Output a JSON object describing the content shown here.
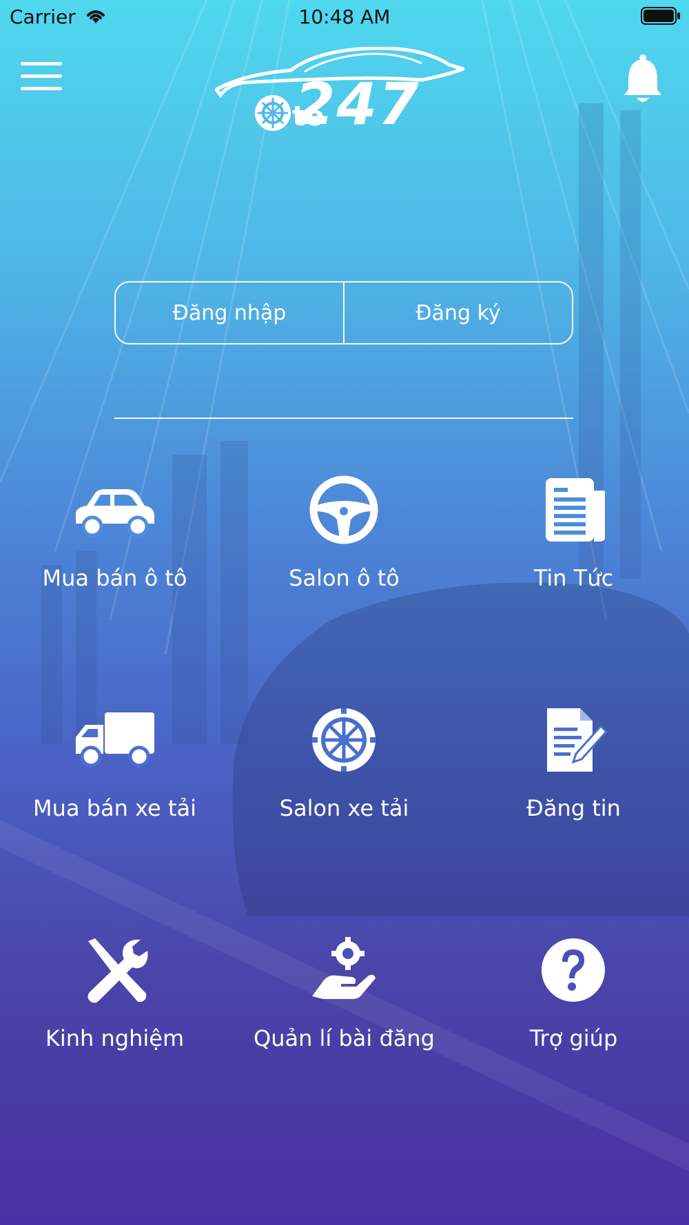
{
  "status_bar": {
    "carrier": "Carrier",
    "time": "10:48 AM"
  },
  "header": {
    "logo_text": "247",
    "logo_prefix": "to",
    "menu_icon": "hamburger-menu-icon",
    "notification_icon": "bell-icon"
  },
  "auth": {
    "login_label": "Đăng nhập",
    "register_label": "Đăng ký"
  },
  "menu": [
    {
      "label": "Mua bán ô tô",
      "icon": "car-icon"
    },
    {
      "label": "Salon ô tô",
      "icon": "steering-wheel-icon"
    },
    {
      "label": "Tin Tức",
      "icon": "newspaper-icon"
    },
    {
      "label": "Mua bán xe tải",
      "icon": "truck-icon"
    },
    {
      "label": "Salon xe tải",
      "icon": "wheel-icon"
    },
    {
      "label": "Đăng tin",
      "icon": "edit-document-icon"
    },
    {
      "label": "Kinh nghiệm",
      "icon": "tools-icon"
    },
    {
      "label": "Quản lí bài đăng",
      "icon": "hand-gear-icon"
    },
    {
      "label": "Trợ giúp",
      "icon": "help-icon"
    }
  ],
  "colors": {
    "gradient_top": "#4fd8ee",
    "gradient_mid": "#4a62c4",
    "gradient_bottom": "#4a2fa2",
    "foreground": "#ffffff"
  }
}
